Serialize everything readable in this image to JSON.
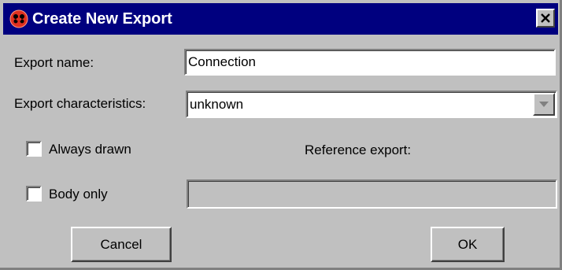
{
  "window": {
    "title": "Create New Export",
    "title_bar_color": "#00007f",
    "icon": "app-red-icon",
    "close_icon": "close-x-icon"
  },
  "form": {
    "export_name": {
      "label": "Export name:",
      "value": "Connection"
    },
    "export_characteristics": {
      "label": "Export characteristics:",
      "selected": "unknown"
    },
    "always_drawn": {
      "label": "Always drawn",
      "checked": false
    },
    "body_only": {
      "label": "Body only",
      "checked": false
    },
    "reference_export": {
      "label": "Reference export:",
      "value": "",
      "enabled": false
    }
  },
  "buttons": {
    "cancel_label": "Cancel",
    "ok_label": "OK"
  }
}
